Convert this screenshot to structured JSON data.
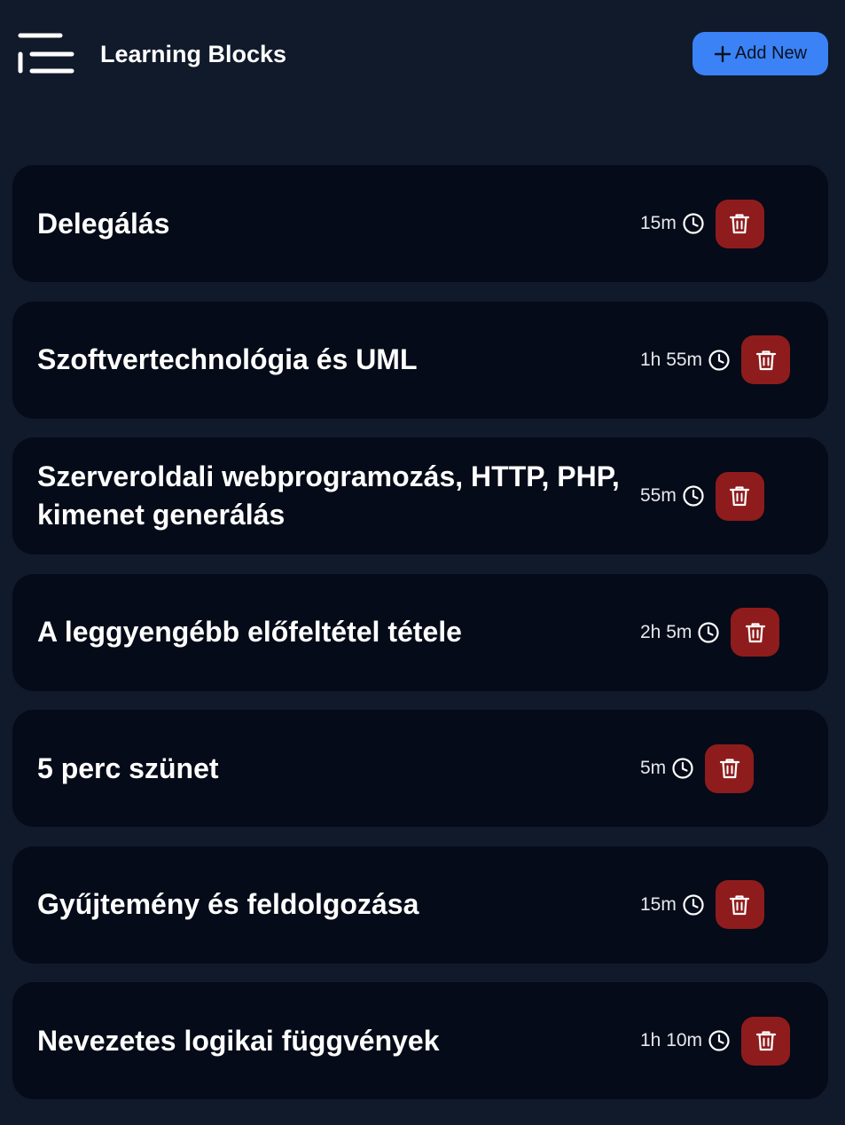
{
  "header": {
    "title": "Learning Blocks",
    "add_label": "Add New",
    "menu_icon": "menu-icon",
    "add_icon": "plus-icon"
  },
  "colors": {
    "background": "#111a2b",
    "card": "#050b18",
    "accent": "#3b82f6",
    "delete": "#8e1c1c"
  },
  "blocks": [
    {
      "title": "Delegálás",
      "duration": "15m"
    },
    {
      "title": "Szoftvertechnológia és UML",
      "duration": "1h 55m"
    },
    {
      "title": "Szerveroldali webprogramozás, HTTP, PHP, kimenet generálás",
      "duration": "55m"
    },
    {
      "title": "A leggyengébb előfeltétel tétele",
      "duration": "2h 5m"
    },
    {
      "title": "5 perc szünet",
      "duration": "5m"
    },
    {
      "title": "Gyűjtemény és feldolgozása",
      "duration": "15m"
    },
    {
      "title": "Nevezetes logikai függvények",
      "duration": "1h 10m"
    }
  ]
}
